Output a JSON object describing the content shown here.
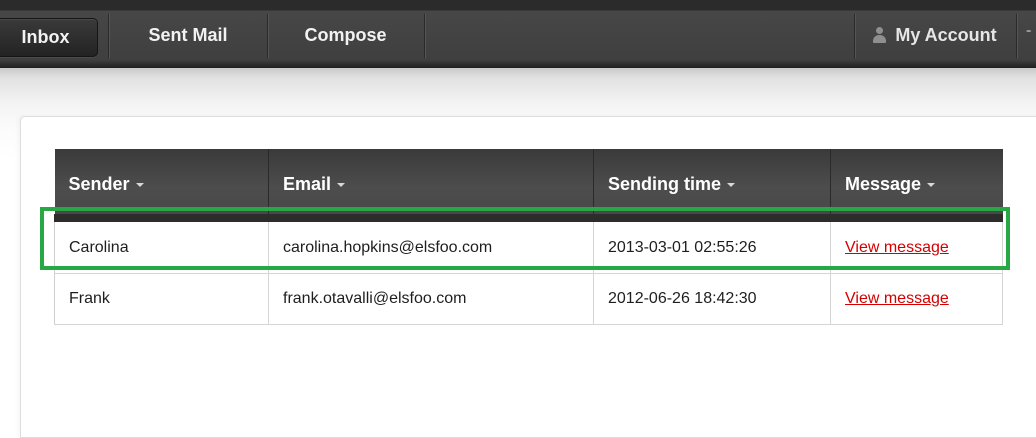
{
  "nav": {
    "inbox": "Inbox",
    "sent_mail": "Sent Mail",
    "compose": "Compose",
    "my_account": "My Account",
    "active": "inbox"
  },
  "table": {
    "headers": [
      "Sender",
      "Email",
      "Sending time",
      "Message"
    ],
    "rows": [
      {
        "sender": "Carolina",
        "email": "carolina.hopkins@elsfoo.com",
        "sending_time": "2013-03-01 02:55:26",
        "message": "View message",
        "highlighted": true
      },
      {
        "sender": "Frank",
        "email": "frank.otavalli@elsfoo.com",
        "sending_time": "2012-06-26 18:42:30",
        "message": "View message",
        "highlighted": false
      }
    ]
  },
  "colors": {
    "highlight": "#27a844",
    "link": "#d40000",
    "nav_background": "#3f3f3f"
  },
  "icons": [
    "user-icon",
    "sort-caret-icon"
  ]
}
